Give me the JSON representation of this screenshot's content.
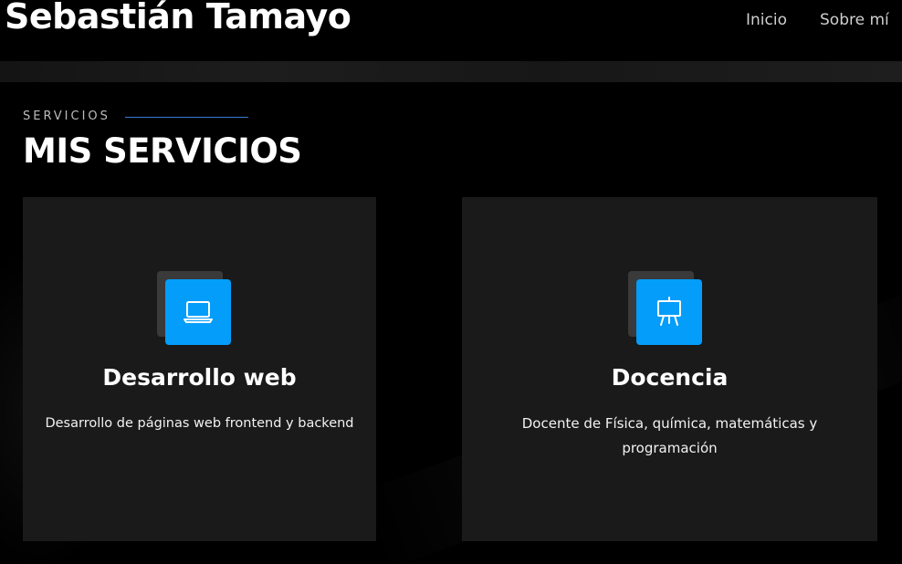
{
  "header": {
    "brand": "Sebastián Tamayo",
    "nav": [
      {
        "label": "Inicio"
      },
      {
        "label": "Sobre mí"
      }
    ]
  },
  "services": {
    "eyebrow": "SERVICIOS",
    "title": "MIS SERVICIOS",
    "items": [
      {
        "icon": "laptop-icon",
        "title": "Desarrollo web",
        "description": "Desarrollo de páginas web frontend y backend"
      },
      {
        "icon": "presentation-easel-icon",
        "title": "Docencia",
        "description": "Docente de Física, química, matemáticas y programación"
      }
    ]
  },
  "colors": {
    "background": "#000000",
    "card": "#1a1a1a",
    "accent": "#049dfa",
    "eyebrow_line": "#3a7bd5"
  }
}
